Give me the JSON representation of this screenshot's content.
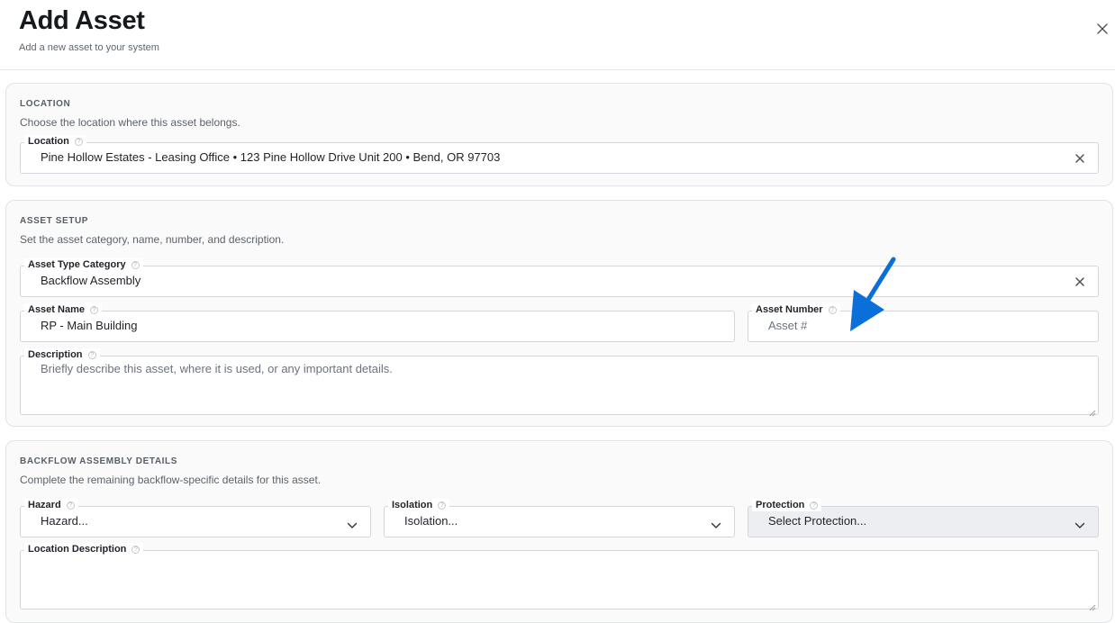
{
  "header": {
    "title": "Add Asset",
    "subtitle": "Add a new asset to your system",
    "close_icon": "close-icon"
  },
  "location_section": {
    "heading": "LOCATION",
    "description": "Choose the location where this asset belongs.",
    "location_field": {
      "label": "Location",
      "value": "Pine Hollow Estates - Leasing Office • 123 Pine Hollow Drive Unit 200 • Bend, OR 97703"
    }
  },
  "asset_setup_section": {
    "heading": "ASSET SETUP",
    "description": "Set the asset category, name, number, and description.",
    "asset_type_category": {
      "label": "Asset Type Category",
      "value": "Backflow Assembly"
    },
    "asset_name": {
      "label": "Asset Name",
      "value": "RP - Main Building"
    },
    "asset_number": {
      "label": "Asset Number",
      "value": "",
      "placeholder": "Asset #"
    },
    "description_field": {
      "label": "Description",
      "value": "",
      "placeholder": "Briefly describe this asset, where it is used, or any important details."
    }
  },
  "backflow_section": {
    "heading": "BACKFLOW ASSEMBLY DETAILS",
    "description": "Complete the remaining backflow-specific details for this asset.",
    "hazard": {
      "label": "Hazard",
      "placeholder": "Hazard..."
    },
    "isolation": {
      "label": "Isolation",
      "placeholder": "Isolation..."
    },
    "protection": {
      "label": "Protection",
      "placeholder": "Select Protection..."
    },
    "location_description": {
      "label": "Location Description",
      "value": ""
    }
  },
  "annotation": {
    "arrow_color": "#0a6fd8",
    "arrow_icon": "arrow-annotation-icon"
  },
  "colors": {
    "accent_blue": "#0a6fd8",
    "border": "#d3d6da",
    "section_bg": "#fafafa"
  }
}
